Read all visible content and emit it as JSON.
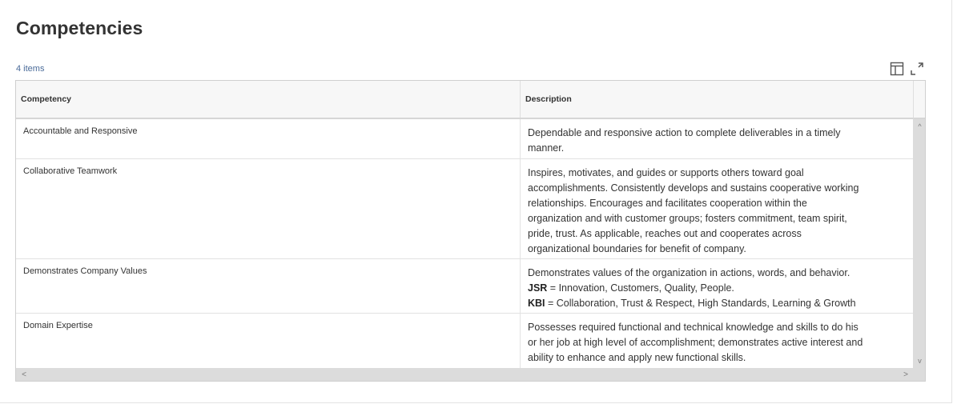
{
  "page": {
    "title": "Competencies",
    "item_count": "4 items"
  },
  "toolbar": {
    "icons": [
      "view-columns-icon",
      "expand-icon"
    ]
  },
  "table": {
    "columns": [
      "Competency",
      "Description"
    ],
    "rows": [
      {
        "competency": "Accountable and Responsive",
        "description": [
          "Dependable and responsive action to complete deliverables in a timely",
          "manner."
        ]
      },
      {
        "competency": "Collaborative Teamwork",
        "description": [
          "Inspires, motivates, and guides or supports others toward goal",
          "accomplishments. Consistently develops and sustains cooperative working",
          "relationships. Encourages and facilitates cooperation within the",
          "organization and with customer groups; fosters commitment, team spirit,",
          "pride, trust. As applicable, reaches out and cooperates across",
          "organizational boundaries for benefit of company."
        ]
      },
      {
        "competency": "Demonstrates Company Values",
        "description_line1": "Demonstrates values of the organization in actions, words, and behavior.",
        "jsr_label": "JSR",
        "jsr_text": " = Innovation, Customers, Quality, People.",
        "kbi_label": "KBI",
        "kbi_text": " = Collaboration, Trust & Respect, High Standards, Learning & Growth"
      },
      {
        "competency": "Domain Expertise",
        "description": [
          "Possesses required functional and technical knowledge and skills to do his",
          "or her job at high level of accomplishment; demonstrates active interest and",
          "ability to enhance and apply new functional skills."
        ]
      }
    ]
  },
  "scrollbars": {
    "up_arrow": "^",
    "down_arrow": "v",
    "left_arrow": "<",
    "right_arrow": ">"
  },
  "colors": {
    "count_text": "#4a6b99",
    "header_bg": "#f7f7f7",
    "scrollbar": "#dcdcdc"
  }
}
